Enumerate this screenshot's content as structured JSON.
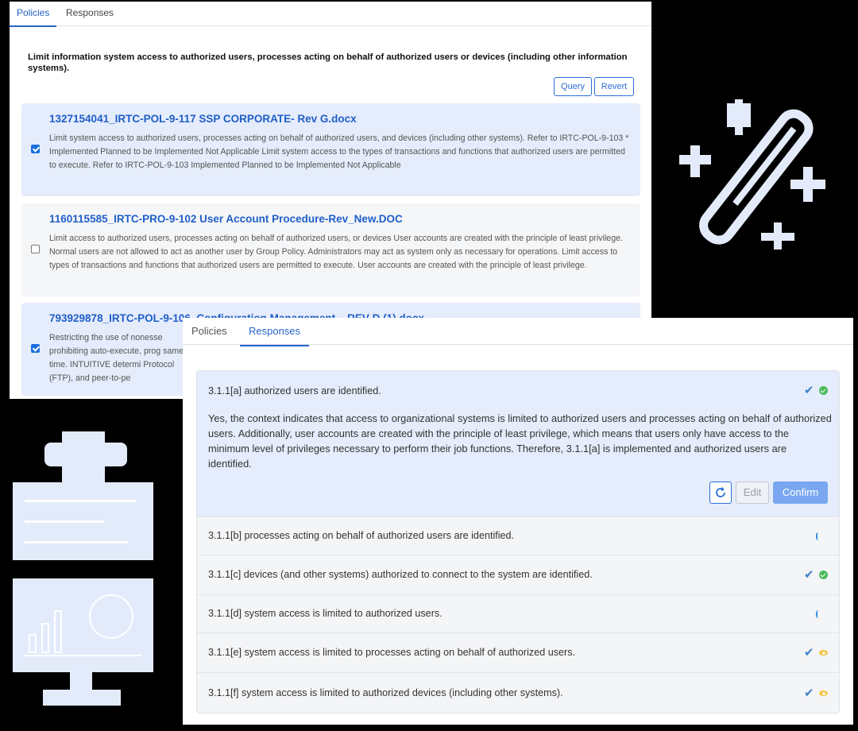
{
  "back_panel": {
    "tabs": [
      "Policies",
      "Responses"
    ],
    "requirement": "Limit information system access to authorized users, processes acting on behalf of authorized users or devices (including other information systems).",
    "query_label": "Query",
    "revert_label": "Revert",
    "documents": [
      {
        "title": "1327154041_IRTC-POL-9-117 SSP CORPORATE- Rev G.docx",
        "checked": true,
        "excerpt": "Limit system access to authorized users, processes acting on behalf of authorized users, and devices (including other systems). Refer to IRTC-POL-9-103 * Implemented Planned to be Implemented Not Applicable Limit system access to the types of transactions and functions that authorized users are permitted to execute. Refer to IRTC-POL-9-103 Implemented Planned to be Implemented Not Applicable"
      },
      {
        "title": "1160115585_IRTC-PRO-9-102 User Account Procedure-Rev_New.DOC",
        "checked": false,
        "excerpt": "Limit access to authorized users, processes acting on behalf of authorized users, or devices User accounts are created with the principle of least privilege. Normal users are not allowed to act as another user by Group Policy. Administrators may act as system only as necessary for operations. Limit access to types of transactions and functions that authorized users are permitted to execute. User accounts are created with the principle of least privilege."
      },
      {
        "title": "793929878_IRTC-POL-9-106_Configuration Management – REV D (1).docx",
        "checked": true,
        "excerpt": "Restricting the use of nonesse prohibiting auto-execute, prog same time. INTUITIVE determi Protocol (FTP), and peer-to-pe"
      }
    ]
  },
  "front_panel": {
    "tabs": [
      "Policies",
      "Responses"
    ],
    "active_tab": "Responses",
    "expanded": {
      "label": "3.1.1[a] authorized users are identified.",
      "status": "verified",
      "answer": "Yes, the context indicates that access to organizational systems is limited to authorized users and processes acting on behalf of authorized users. Additionally, user accounts are created with the principle of least privilege, which means that users only have access to the minimum level of privileges necessary to perform their job functions. Therefore, 3.1.1[a] is implemented and authorized users are identified.",
      "edit_label": "Edit",
      "confirm_label": "Confirm"
    },
    "items": [
      {
        "label": "3.1.1[b] processes acting on behalf of authorized users are identified.",
        "status": "loading"
      },
      {
        "label": "3.1.1[c] devices (and other systems) authorized to connect to the system are identified.",
        "status": "verified"
      },
      {
        "label": "3.1.1[d] system access is limited to authorized users.",
        "status": "loading"
      },
      {
        "label": "3.1.1[e] system access is limited to processes acting on behalf of authorized users.",
        "status": "review"
      },
      {
        "label": "3.1.1[f] system access is limited to authorized devices (including other systems).",
        "status": "review"
      }
    ]
  },
  "colors": {
    "accent": "#2563c9",
    "selected_bg": "#e5ecfb",
    "decoration": "#e3ebfb",
    "verified": "#4cbb5b",
    "review": "#f5c542"
  },
  "icons": [
    "checkmark-icon",
    "verified-circle-icon",
    "eye-icon",
    "spinner-icon",
    "refresh-icon",
    "key-sparkle-icon",
    "robot-card-icon",
    "analytics-monitor-icon"
  ]
}
